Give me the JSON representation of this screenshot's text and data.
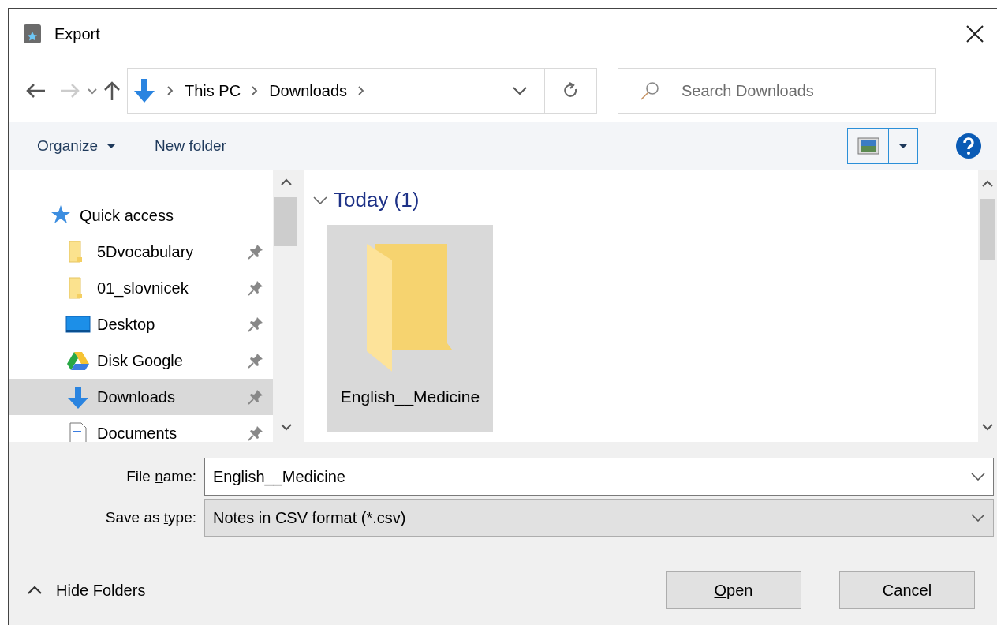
{
  "window": {
    "title": "Export"
  },
  "nav": {
    "back_enabled": true,
    "forward_enabled": false
  },
  "address": {
    "crumbs": [
      "This PC",
      "Downloads"
    ]
  },
  "search": {
    "placeholder": "Search Downloads"
  },
  "toolbar": {
    "organize": "Organize",
    "new_folder": "New folder"
  },
  "sidebar": {
    "items": [
      {
        "label": "Quick access",
        "kind": "star",
        "pinned": false,
        "selected": false
      },
      {
        "label": "5Dvocabulary",
        "kind": "folder",
        "pinned": true,
        "selected": false
      },
      {
        "label": "01_slovnicek",
        "kind": "folder",
        "pinned": true,
        "selected": false
      },
      {
        "label": "Desktop",
        "kind": "desktop",
        "pinned": true,
        "selected": false
      },
      {
        "label": "Disk Google",
        "kind": "drive",
        "pinned": true,
        "selected": false
      },
      {
        "label": "Downloads",
        "kind": "download",
        "pinned": true,
        "selected": true
      },
      {
        "label": "Documents",
        "kind": "document",
        "pinned": true,
        "selected": false
      }
    ]
  },
  "content": {
    "group": "Today (1)",
    "items": [
      {
        "name": "English__Medicine",
        "selected": true
      }
    ]
  },
  "file_name": {
    "label": {
      "before": "File ",
      "access_key": "n",
      "after": "ame:"
    },
    "value": "English__Medicine"
  },
  "save_type": {
    "label": {
      "before": "Save as ",
      "access_key": "t",
      "after": "ype:"
    },
    "value": "Notes in CSV format (*.csv)"
  },
  "hide_folders": "Hide Folders",
  "buttons": [
    {
      "label": {
        "access_key": "O",
        "after": "pen"
      }
    },
    {
      "label": {
        "before": "Cancel"
      }
    }
  ]
}
